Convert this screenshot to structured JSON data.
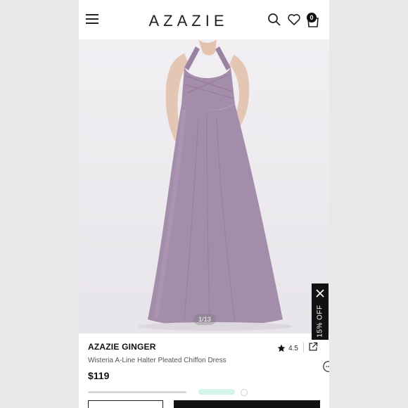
{
  "header": {
    "logo": "AZAZIE",
    "cart_count": "0"
  },
  "hero": {
    "image_counter": "1/13",
    "dress_color": "#a48cab"
  },
  "promo": {
    "label": "15% OFF"
  },
  "product": {
    "brand": "AZAZIE GINGER",
    "name": "Wisteria A-Line Halter Pleated Chiffon Dress",
    "price": "$119",
    "rating": "4.5"
  },
  "icons": [
    "menu-icon",
    "search-icon",
    "heart-icon",
    "bag-icon",
    "close-icon",
    "star-icon",
    "share-icon",
    "chat-icon"
  ]
}
